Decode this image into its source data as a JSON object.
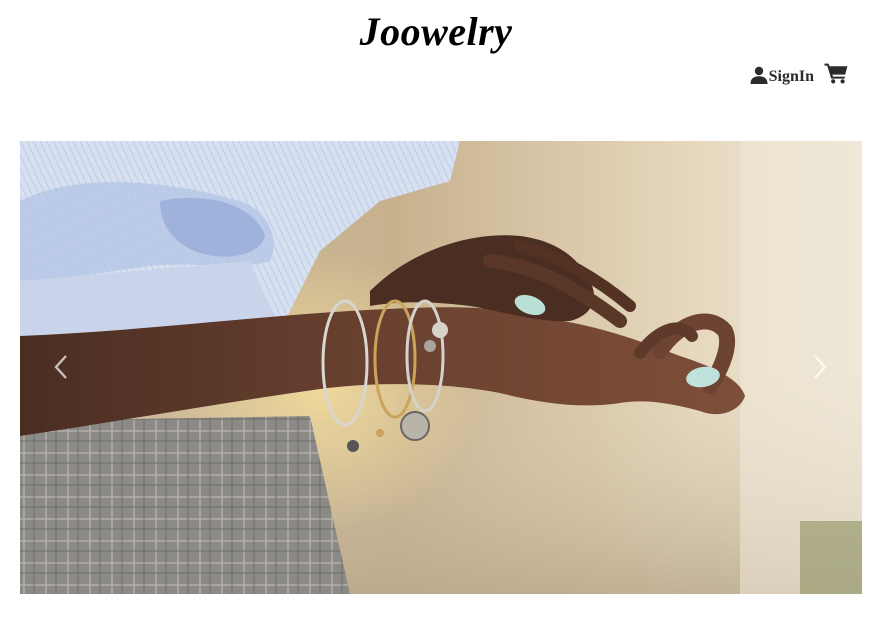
{
  "header": {
    "brand": "Joowelry",
    "signin_label": "SignIn",
    "signin_icon": "user-icon",
    "cart_icon": "shopping-cart-icon"
  },
  "carousel": {
    "image": "woman-wrist-bangle-bracelets-photo",
    "prev_icon": "chevron-left-icon",
    "next_icon": "chevron-right-icon"
  },
  "colors": {
    "text": "#000000",
    "icon": "#2b2b2b",
    "background": "#ffffff"
  }
}
